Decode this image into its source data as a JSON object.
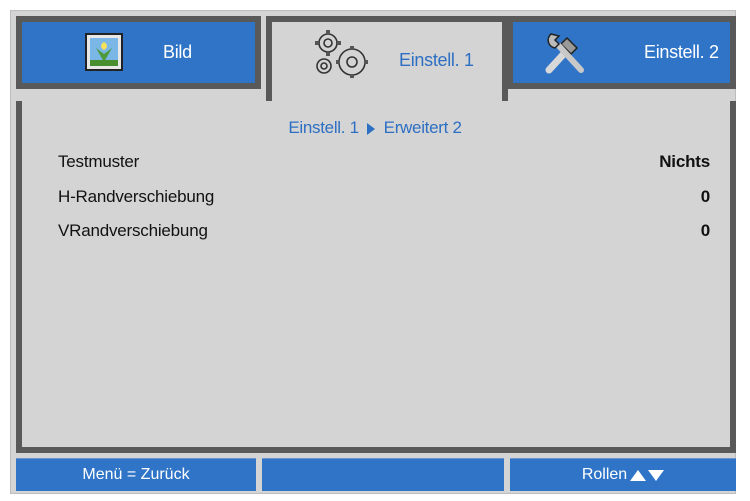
{
  "tabs": [
    {
      "label": "Bild",
      "icon": "picture-icon",
      "active": false
    },
    {
      "label": "Einstell. 1",
      "icon": "gears-icon",
      "active": true
    },
    {
      "label": "Einstell. 2",
      "icon": "tools-icon",
      "active": false
    }
  ],
  "breadcrumb": {
    "parent": "Einstell. 1",
    "child": "Erweitert 2"
  },
  "settings": [
    {
      "label": "Testmuster",
      "value": "Nichts"
    },
    {
      "label": "H-Randverschiebung",
      "value": "0"
    },
    {
      "label": "VRandverschiebung",
      "value": "0"
    }
  ],
  "footer": {
    "back_label": "Menü = Zurück",
    "middle_label": "",
    "scroll_label": "Rollen"
  },
  "colors": {
    "tab_blue": "#2f74c7",
    "border_dark": "#595959",
    "panel_gray": "#d4d4d4",
    "accent_text": "#2d6fc3"
  }
}
